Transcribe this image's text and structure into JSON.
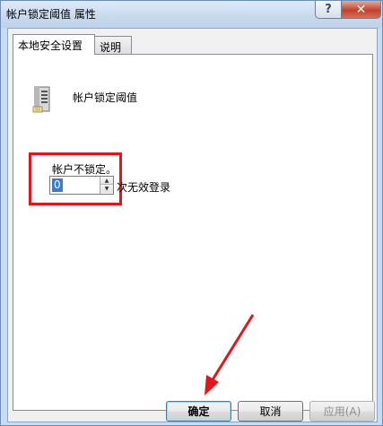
{
  "window": {
    "title": "帐户锁定阈值 属性",
    "help_label": "?",
    "close_label": "✕"
  },
  "tabs": [
    {
      "label": "本地安全设置",
      "active": true
    },
    {
      "label": "说明",
      "active": false
    }
  ],
  "policy": {
    "icon": "server-icon",
    "name": "帐户锁定阈值"
  },
  "threshold": {
    "label": "帐户不锁定。",
    "value": "0",
    "suffix": "次无效登录"
  },
  "buttons": {
    "ok": "确定",
    "cancel": "取消",
    "apply": "应用(A)"
  },
  "colors": {
    "highlight_box": "#e3151a",
    "arrow": "#e3151a"
  }
}
